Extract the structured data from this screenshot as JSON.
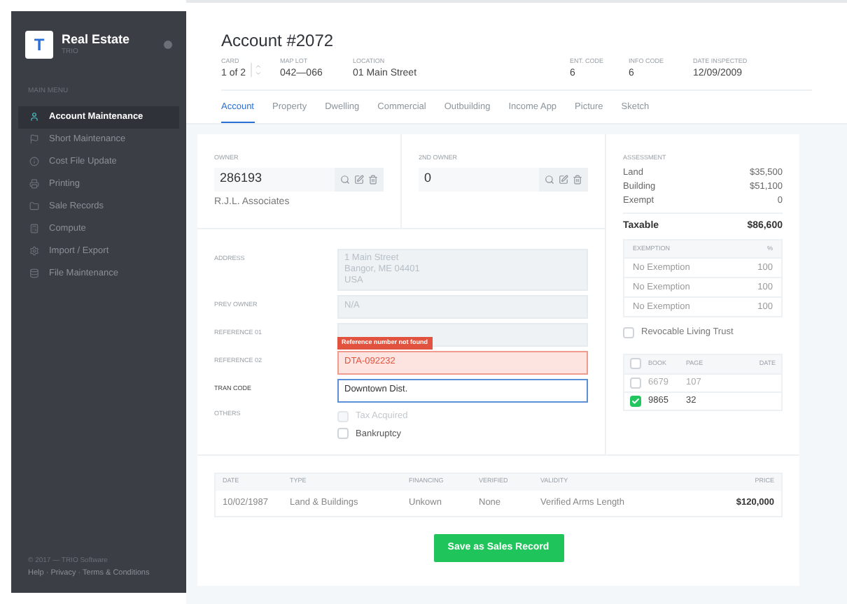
{
  "sidebar": {
    "logo_letter": "T",
    "app_title": "Real Estate",
    "app_subtitle": "TRIO",
    "menu_heading": "MAIN MENU",
    "items": [
      {
        "label": "Account Maintenance",
        "selected": true
      },
      {
        "label": "Short Maintenance",
        "selected": false
      },
      {
        "label": "Cost File Update",
        "selected": false
      },
      {
        "label": "Printing",
        "selected": false
      },
      {
        "label": "Sale Records",
        "selected": false
      },
      {
        "label": "Compute",
        "selected": false
      },
      {
        "label": "Import / Export",
        "selected": false
      },
      {
        "label": "File Maintenance",
        "selected": false
      }
    ],
    "footer": "© 2017 — TRIO Software",
    "footer_links": "Help · Privacy · Terms & Conditions"
  },
  "header": {
    "title": "Account #2072",
    "card": {
      "label": "CARD",
      "value": "1 of 2"
    },
    "fields": [
      {
        "label": "MAP LOT",
        "value": "042—066"
      },
      {
        "label": "LOCATION",
        "value": "01 Main Street"
      },
      {
        "label": "ENT. CODE",
        "value": "6"
      },
      {
        "label": "INFO CODE",
        "value": "6"
      },
      {
        "label": "DATE INSPECTED",
        "value": "12/09/2009"
      }
    ]
  },
  "tabs": [
    {
      "label": "Account",
      "selected": true
    },
    {
      "label": "Property",
      "selected": false
    },
    {
      "label": "Dwelling",
      "selected": false
    },
    {
      "label": "Commercial",
      "selected": false
    },
    {
      "label": "Outbuilding",
      "selected": false
    },
    {
      "label": "Income App",
      "selected": false
    },
    {
      "label": "Picture",
      "selected": false
    },
    {
      "label": "Sketch",
      "selected": false
    }
  ],
  "owners": [
    {
      "label": "OWNER",
      "value": "286193",
      "name": "R.J.L. Associates"
    },
    {
      "label": "2ND OWNER",
      "value": "0"
    }
  ],
  "form": [
    {
      "label": "ADDRESS",
      "lines": [
        "1 Main Street",
        "Bangor, ME 04401",
        "USA"
      ],
      "disabled": true,
      "invalid": false,
      "focused": false
    },
    {
      "label": "PREV OWNER",
      "lines": [
        "N/A"
      ],
      "disabled": true,
      "invalid": false,
      "focused": false
    },
    {
      "label": "REFERENCE 01",
      "disabled": true,
      "invalid": false,
      "focused": false
    },
    {
      "label": "REFERENCE 02",
      "lines": [
        "DTA-092232"
      ],
      "disabled": false,
      "invalid": true,
      "focused": false,
      "error": "Reference number not found"
    },
    {
      "label": "TRAN CODE",
      "lines": [
        "Downtown Dist."
      ],
      "disabled": false,
      "invalid": false,
      "focused": true
    }
  ],
  "others": {
    "label": "OTHERS",
    "options": [
      {
        "label": "Tax Acquired",
        "checked": false,
        "disabled": true
      },
      {
        "label": "Bankruptcy",
        "checked": false,
        "disabled": false
      }
    ]
  },
  "assessment": {
    "label": "ASSESSMENT",
    "rows": [
      {
        "label": "Land",
        "value": "$35,500"
      },
      {
        "label": "Building",
        "value": "$51,100"
      },
      {
        "label": "Exempt",
        "value": "0"
      }
    ],
    "total": {
      "label": "Taxable",
      "value": "$86,600"
    }
  },
  "exemptions": {
    "columns": [
      "EXEMPTION",
      "%"
    ],
    "rows": [
      [
        "No Exemption",
        "100"
      ],
      [
        "No Exemption",
        "100"
      ],
      [
        "No Exemption",
        "100"
      ]
    ]
  },
  "trust": {
    "label": "Revocable Living Trust",
    "checked": false
  },
  "books": {
    "all_checked": false,
    "columns": [
      "BOOK",
      "PAGE",
      "DATE"
    ],
    "rows": [
      {
        "book": "6679",
        "page": "107",
        "checked": false
      },
      {
        "book": "9865",
        "page": "32",
        "checked": true
      }
    ]
  },
  "sales": {
    "columns": [
      "DATE",
      "TYPE",
      "FINANCING",
      "VERIFIED",
      "VALIDITY",
      "PRICE"
    ],
    "rows": [
      [
        "10/02/1987",
        "Land & Buildings",
        "Unkown",
        "None",
        "Verified Arms Length",
        "$120,000"
      ]
    ]
  },
  "save_button": "Save as Sales Record"
}
